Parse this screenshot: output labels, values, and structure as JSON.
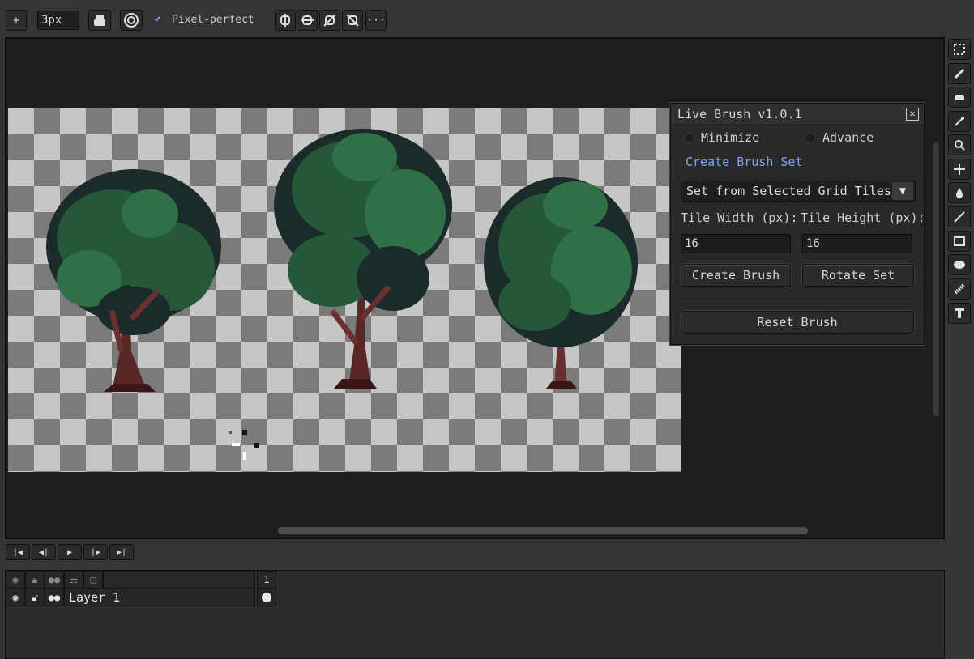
{
  "toolbar": {
    "add_label": "+",
    "brush_size": "3px",
    "pixel_perfect_label": "Pixel-perfect",
    "more_label": "···"
  },
  "live_brush": {
    "title": "Live Brush v1.0.1",
    "minimize_label": "Minimize",
    "advance_label": "Advance",
    "create_brush_set_label": "Create Brush Set",
    "set_source": "Set from Selected Grid Tiles",
    "tile_width_label": "Tile Width (px):",
    "tile_height_label": "Tile Height (px):",
    "tile_width_value": "16",
    "tile_height_value": "16",
    "create_brush_label": "Create Brush",
    "rotate_set_label": "Rotate Set",
    "reset_brush_label": "Reset Brush"
  },
  "timeline": {
    "frame_number": "1",
    "layer_name": "Layer 1"
  },
  "colors": {
    "accent_link": "#7aa6f0",
    "leaf_dark": "#1b2a2b",
    "leaf_mid": "#245838",
    "leaf_light": "#2f7047",
    "trunk": "#6a3030"
  },
  "icons": {
    "tools": [
      "marquee-icon",
      "pencil-icon",
      "eraser-icon",
      "eyedropper-icon",
      "zoom-icon",
      "move-icon",
      "fill-icon",
      "line-icon",
      "rectangle-icon",
      "ellipse-icon",
      "blur-icon",
      "text-icon"
    ]
  }
}
